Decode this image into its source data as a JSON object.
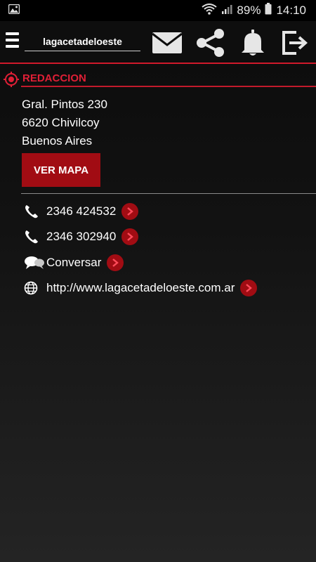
{
  "status": {
    "battery": "89%",
    "time": "14:10"
  },
  "appbar": {
    "title": "lagacetadeloeste"
  },
  "section": {
    "title": "REDACCION"
  },
  "address": [
    "Gral. Pintos 230",
    "6620 Chivilcoy",
    "Buenos Aires"
  ],
  "map_button": "VER MAPA",
  "contacts": [
    {
      "icon": "phone-icon",
      "text": "2346 424532"
    },
    {
      "icon": "phone-icon",
      "text": "2346 302940"
    },
    {
      "icon": "chat-icon",
      "text": "Conversar"
    },
    {
      "icon": "globe-icon",
      "text": "http://www.lagacetadeloeste.com.ar"
    }
  ],
  "colors": {
    "accent": "#d0192b",
    "button": "#a10c13"
  }
}
